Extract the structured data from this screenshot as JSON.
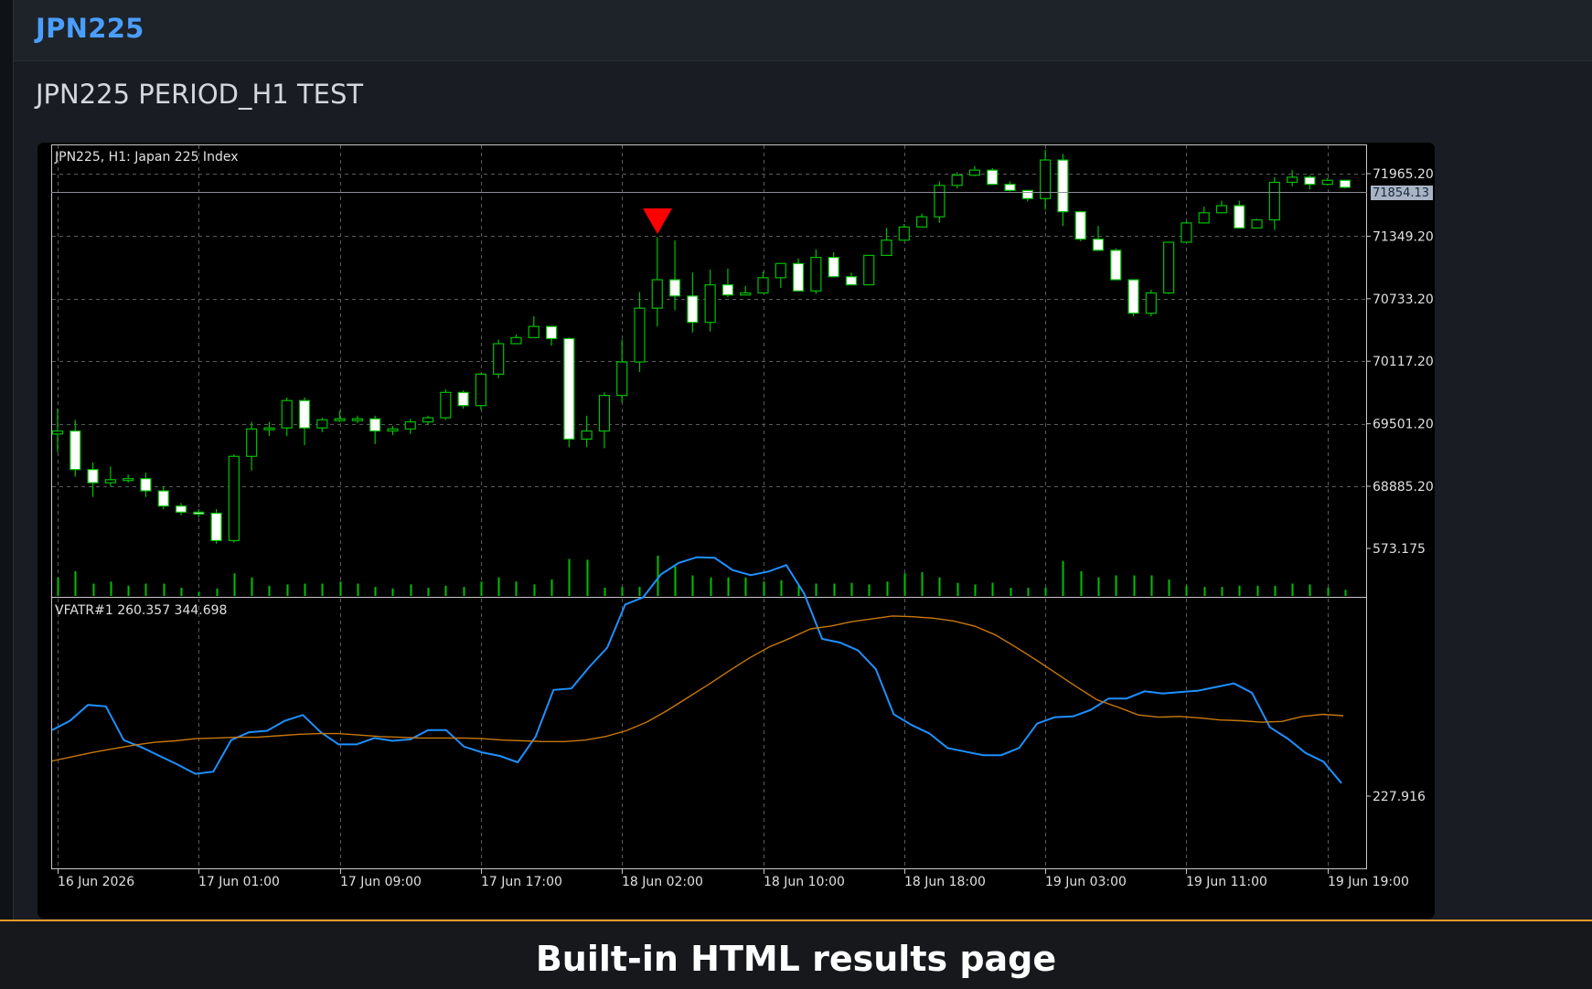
{
  "header": {
    "symbol": "JPN225",
    "report_title": "JPN225 PERIOD_H1 TEST"
  },
  "chart": {
    "info_label": "JPN225, H1:  Japan 225 Index",
    "current_price": "71854.13",
    "price_ticks": [
      "71965.20",
      "71349.20",
      "70733.20",
      "70117.20",
      "69501.20",
      "68885.20"
    ],
    "indicator_label": "VFATR#1 260.357 344.698",
    "indicator_ticks": [
      "573.175",
      "227.916"
    ],
    "time_labels": [
      "16 Jun 2026",
      "17 Jun 01:00",
      "17 Jun 09:00",
      "17 Jun 17:00",
      "18 Jun 02:00",
      "18 Jun 10:00",
      "18 Jun 18:00",
      "19 Jun 03:00",
      "19 Jun 11:00",
      "19 Jun 19:00"
    ],
    "sell_signal_marker": "red down arrow",
    "colors": {
      "background": "#000000",
      "bull_candle": "#000000",
      "bear_candle": "#ffffff",
      "wick": "#00c000",
      "volume": "#00c000",
      "atr_fast": "#1e90ff",
      "atr_slow": "#c8780a",
      "signal": "#ff0000",
      "price_label_bg": "#a8b4c4"
    }
  },
  "chart_data": {
    "type": "candlestick",
    "price_axis_ticks": [
      71965.2,
      71349.2,
      70733.2,
      70117.2,
      69501.2,
      68885.2
    ],
    "current_price": 71854.13,
    "candles": [
      [
        69400,
        69430,
        69220,
        69650
      ],
      [
        69430,
        69050,
        68980,
        69540
      ],
      [
        69050,
        68920,
        68780,
        69120
      ],
      [
        68920,
        68950,
        68880,
        69080
      ],
      [
        68950,
        68960,
        68920,
        69000
      ],
      [
        68960,
        68840,
        68780,
        69020
      ],
      [
        68840,
        68690,
        68660,
        68880
      ],
      [
        68690,
        68630,
        68600,
        68720
      ],
      [
        68630,
        68620,
        68580,
        68660
      ],
      [
        68620,
        68350,
        68320,
        68660
      ],
      [
        68350,
        69180,
        68330,
        69200
      ],
      [
        69180,
        69450,
        69040,
        69520
      ],
      [
        69450,
        69460,
        69380,
        69520
      ],
      [
        69460,
        69730,
        69380,
        69760
      ],
      [
        69730,
        69460,
        69290,
        69760
      ],
      [
        69460,
        69540,
        69420,
        69560
      ],
      [
        69540,
        69550,
        69520,
        69630
      ],
      [
        69550,
        69550,
        69510,
        69580
      ],
      [
        69550,
        69430,
        69300,
        69580
      ],
      [
        69430,
        69450,
        69390,
        69480
      ],
      [
        69450,
        69520,
        69400,
        69550
      ],
      [
        69520,
        69560,
        69490,
        69580
      ],
      [
        69560,
        69810,
        69540,
        69840
      ],
      [
        69810,
        69680,
        69650,
        69830
      ],
      [
        69680,
        69990,
        69640,
        70000
      ],
      [
        69990,
        70290,
        69950,
        70330
      ],
      [
        70290,
        70350,
        70330,
        70380
      ],
      [
        70350,
        70460,
        70400,
        70560
      ],
      [
        70460,
        70340,
        70270,
        70420
      ],
      [
        70340,
        69350,
        69270,
        70350
      ],
      [
        69350,
        69430,
        69270,
        69580
      ],
      [
        69430,
        69780,
        69260,
        69810
      ],
      [
        69780,
        70110,
        69710,
        70330
      ],
      [
        70110,
        70640,
        70010,
        70800
      ],
      [
        70640,
        70920,
        70460,
        71340
      ],
      [
        70920,
        70760,
        70620,
        71310
      ],
      [
        70760,
        70500,
        70400,
        70990
      ],
      [
        70500,
        70870,
        70410,
        71020
      ],
      [
        70870,
        70770,
        70750,
        71030
      ],
      [
        70770,
        70790,
        70770,
        70860
      ],
      [
        70790,
        70940,
        70790,
        71000
      ],
      [
        70940,
        71080,
        70840,
        71080
      ],
      [
        71080,
        70810,
        70830,
        71130
      ],
      [
        70810,
        71140,
        70780,
        71220
      ],
      [
        71140,
        70950,
        70990,
        71190
      ],
      [
        70950,
        70870,
        70910,
        70990
      ],
      [
        70870,
        71160,
        70890,
        71160
      ],
      [
        71160,
        71310,
        71260,
        71430
      ],
      [
        71310,
        71440,
        71330,
        71470
      ],
      [
        71440,
        71540,
        71450,
        71570
      ],
      [
        71540,
        71850,
        71480,
        71890
      ],
      [
        71850,
        71950,
        71820,
        71980
      ],
      [
        71950,
        72000,
        71940,
        72040
      ],
      [
        72000,
        71860,
        71860,
        72020
      ],
      [
        71860,
        71800,
        71790,
        71890
      ],
      [
        71800,
        71720,
        71690,
        71730
      ],
      [
        71720,
        72100,
        71610,
        72200
      ],
      [
        72100,
        71590,
        71450,
        72160
      ],
      [
        71590,
        71320,
        71300,
        71560
      ],
      [
        71320,
        71210,
        71220,
        71450
      ],
      [
        71210,
        70920,
        70950,
        71230
      ],
      [
        70920,
        70590,
        70560,
        70920
      ],
      [
        70590,
        70790,
        70560,
        70820
      ],
      [
        70790,
        71290,
        70780,
        71290
      ],
      [
        71290,
        71480,
        71310,
        71500
      ],
      [
        71480,
        71580,
        71520,
        71640
      ],
      [
        71580,
        71650,
        71610,
        71700
      ],
      [
        71650,
        71430,
        71430,
        71700
      ],
      [
        71430,
        71510,
        71440,
        71520
      ],
      [
        71510,
        71880,
        71410,
        71930
      ],
      [
        71880,
        71930,
        71840,
        72000
      ],
      [
        71930,
        71860,
        71810,
        71950
      ],
      [
        71860,
        71900,
        71850,
        71920
      ],
      [
        71900,
        71830,
        71820,
        71890
      ]
    ],
    "volume_relative": [
      0.45,
      0.6,
      0.3,
      0.35,
      0.25,
      0.3,
      0.3,
      0.2,
      0.1,
      0.18,
      0.55,
      0.45,
      0.25,
      0.28,
      0.3,
      0.3,
      0.35,
      0.3,
      0.22,
      0.18,
      0.28,
      0.2,
      0.25,
      0.22,
      0.35,
      0.45,
      0.35,
      0.28,
      0.4,
      0.9,
      0.88,
      0.2,
      0.22,
      0.22,
      0.98,
      0.72,
      0.5,
      0.45,
      0.45,
      0.45,
      0.35,
      0.38,
      0.28,
      0.3,
      0.3,
      0.32,
      0.28,
      0.35,
      0.55,
      0.58,
      0.45,
      0.32,
      0.28,
      0.32,
      0.2,
      0.2,
      0.2,
      0.85,
      0.6,
      0.45,
      0.5,
      0.5,
      0.5,
      0.4,
      0.25,
      0.22,
      0.22,
      0.25,
      0.25,
      0.25,
      0.3,
      0.28,
      0.2,
      0.15
    ],
    "series": [
      {
        "name": "VFATR fast",
        "values": [
          320,
          333,
          355,
          353,
          306,
          296,
          284,
          272,
          259,
          262,
          306,
          317,
          319,
          333,
          341,
          317,
          300,
          300,
          309,
          305,
          307,
          320,
          320,
          297,
          289,
          284,
          275,
          311,
          376,
          378,
          408,
          435,
          495,
          505,
          537,
          553,
          561,
          560,
          543,
          536,
          541,
          550,
          510,
          447,
          442,
          431,
          405,
          342,
          327,
          315,
          295,
          290,
          285,
          285,
          295,
          329,
          338,
          339,
          348,
          364,
          364,
          374,
          371,
          373,
          375,
          380,
          385,
          372,
          324,
          308,
          288,
          276,
          246
        ]
      },
      {
        "name": "VFATR slow",
        "values": [
          277,
          283,
          289,
          294,
          299,
          303,
          305,
          308,
          309,
          310,
          310,
          312,
          314,
          315,
          315,
          313,
          311,
          310,
          309,
          309,
          309,
          308,
          306,
          305,
          304,
          304,
          306,
          311,
          319,
          331,
          347,
          365,
          383,
          402,
          420,
          436,
          448,
          461,
          465,
          471,
          475,
          479,
          478,
          476,
          472,
          465,
          453,
          436,
          418,
          399,
          380,
          362,
          352,
          341,
          338,
          339,
          337,
          334,
          333,
          331,
          332,
          339,
          342,
          340
        ]
      }
    ],
    "indicator_axis_ticks": [
      573.175,
      227.916
    ],
    "signals": [
      {
        "type": "sell",
        "candle_index": 35
      }
    ]
  },
  "footer": {
    "caption": "Built-in HTML results page"
  }
}
